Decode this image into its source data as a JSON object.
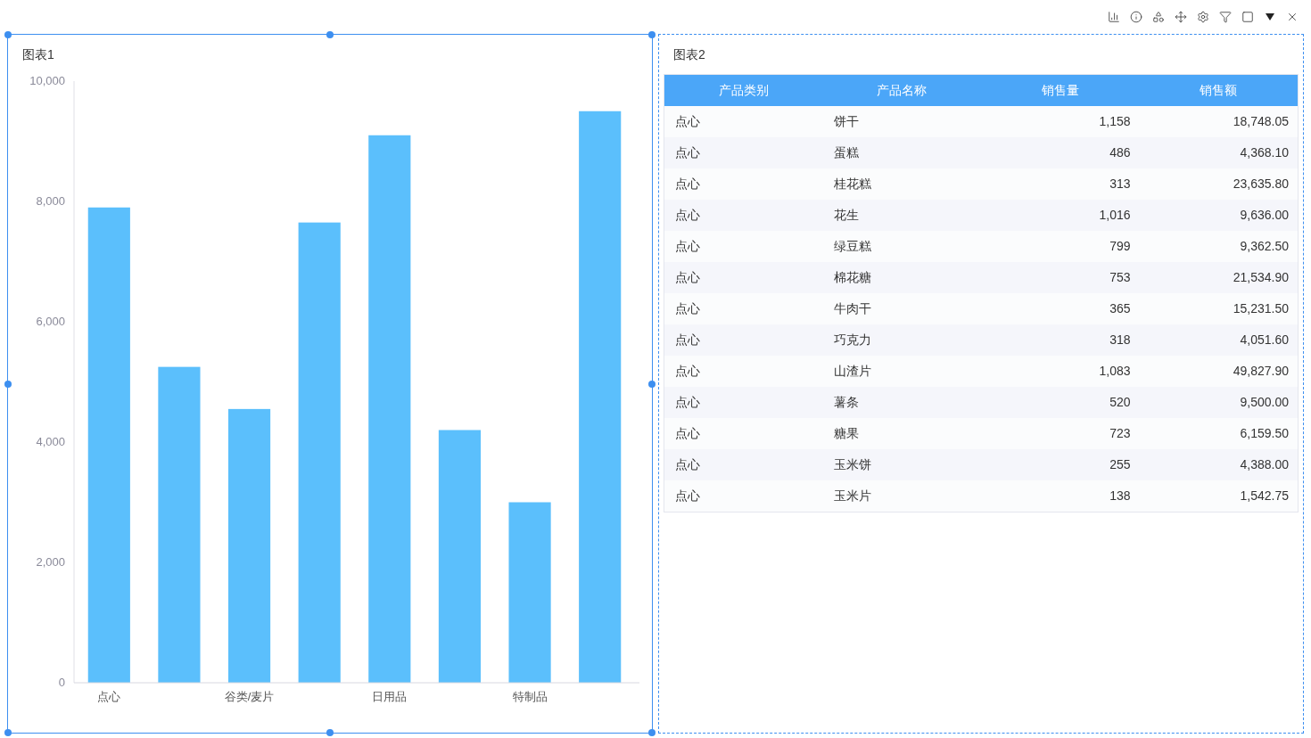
{
  "toolbar": {
    "buttons": [
      {
        "kind": "chart"
      },
      {
        "kind": "info"
      },
      {
        "kind": "shapes"
      },
      {
        "kind": "move"
      },
      {
        "kind": "settings"
      },
      {
        "kind": "filter"
      },
      {
        "kind": "square"
      },
      {
        "kind": "dropdown"
      },
      {
        "kind": "close"
      }
    ]
  },
  "chart1": {
    "title": "图表1",
    "selected": true,
    "chart_data": {
      "type": "bar",
      "categories": [
        "点心",
        null,
        "谷类/麦片",
        null,
        "日用品",
        null,
        "特制品",
        null
      ],
      "series": [
        {
          "color": "#5bbffc",
          "values": [
            7900,
            5250,
            4550,
            7650,
            9100,
            4200,
            3000,
            9500
          ]
        }
      ],
      "ylim": [
        0,
        10000
      ],
      "yticks": [
        {
          "value": 0,
          "label": "0"
        },
        {
          "value": 2000,
          "label": "2,000"
        },
        {
          "value": 4000,
          "label": "4,000"
        },
        {
          "value": 6000,
          "label": "6,000"
        },
        {
          "value": 8000,
          "label": "8,000"
        },
        {
          "value": 10000,
          "label": "10,000"
        }
      ]
    }
  },
  "chart2": {
    "title": "图表2",
    "selected": false,
    "table": {
      "columns": [
        "产品类别",
        "产品名称",
        "销售量",
        "销售额"
      ],
      "rows": [
        [
          "点心",
          "饼干",
          "1,158",
          "18,748.05"
        ],
        [
          "点心",
          "蛋糕",
          "486",
          "4,368.10"
        ],
        [
          "点心",
          "桂花糕",
          "313",
          "23,635.80"
        ],
        [
          "点心",
          "花生",
          "1,016",
          "9,636.00"
        ],
        [
          "点心",
          "绿豆糕",
          "799",
          "9,362.50"
        ],
        [
          "点心",
          "棉花糖",
          "753",
          "21,534.90"
        ],
        [
          "点心",
          "牛肉干",
          "365",
          "15,231.50"
        ],
        [
          "点心",
          "巧克力",
          "318",
          "4,051.60"
        ],
        [
          "点心",
          "山渣片",
          "1,083",
          "49,827.90"
        ],
        [
          "点心",
          "薯条",
          "520",
          "9,500.00"
        ],
        [
          "点心",
          "糖果",
          "723",
          "6,159.50"
        ],
        [
          "点心",
          "玉米饼",
          "255",
          "4,388.00"
        ],
        [
          "点心",
          "玉米片",
          "138",
          "1,542.75"
        ]
      ]
    }
  }
}
